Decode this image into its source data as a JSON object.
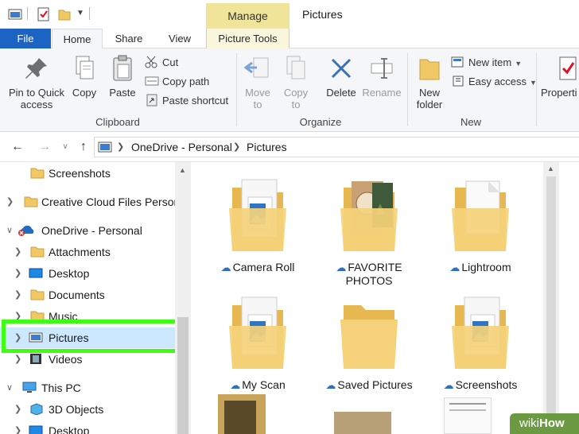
{
  "window": {
    "title": "Pictures",
    "context_tab_group": "Manage"
  },
  "tabs": [
    {
      "label": "File"
    },
    {
      "label": "Home"
    },
    {
      "label": "Share"
    },
    {
      "label": "View"
    },
    {
      "label": "Picture Tools"
    }
  ],
  "ribbon": {
    "clipboard": {
      "group_label": "Clipboard",
      "pin_label": "Pin to Quick\naccess",
      "copy_label": "Copy",
      "paste_label": "Paste",
      "cut_label": "Cut",
      "copy_path_label": "Copy path",
      "paste_shortcut_label": "Paste shortcut"
    },
    "organize": {
      "group_label": "Organize",
      "move_to_label": "Move\nto",
      "copy_to_label": "Copy\nto",
      "delete_label": "Delete",
      "rename_label": "Rename"
    },
    "new": {
      "group_label": "New",
      "new_folder_label": "New\nfolder",
      "new_item_label": "New item",
      "easy_access_label": "Easy access"
    },
    "open": {
      "properties_label": "Properti"
    }
  },
  "address": {
    "crumbs": [
      "OneDrive - Personal",
      "Pictures"
    ]
  },
  "nav": {
    "items": [
      {
        "label": "Screenshots"
      },
      {
        "label": "Creative Cloud Files Persona"
      },
      {
        "label": "OneDrive - Personal"
      },
      {
        "label": "Attachments"
      },
      {
        "label": "Desktop"
      },
      {
        "label": "Documents"
      },
      {
        "label": "Music"
      },
      {
        "label": "Pictures"
      },
      {
        "label": "Videos"
      },
      {
        "label": "This PC"
      },
      {
        "label": "3D Objects"
      },
      {
        "label": "Desktop"
      }
    ]
  },
  "content": {
    "folders": [
      {
        "name": "Camera Roll"
      },
      {
        "name": "FAVORITE PHOTOS"
      },
      {
        "name": "Lightroom"
      },
      {
        "name": "My Scan"
      },
      {
        "name": "Saved Pictures"
      },
      {
        "name": "Screenshots"
      }
    ]
  },
  "watermark": {
    "prefix": "wiki",
    "suffix": "How"
  },
  "colors": {
    "accent": "#1b64c4",
    "manage": "#efe497",
    "folder": "#f0c866",
    "highlight": "#3cff13",
    "selected": "#cce8ff"
  },
  "icons": [
    "back-arrow-icon",
    "forward-arrow-icon",
    "up-arrow-icon",
    "pin-icon",
    "scissors-icon",
    "delete-x-icon",
    "folder-icon",
    "cloud-icon",
    "onedrive-icon",
    "computer-icon"
  ]
}
